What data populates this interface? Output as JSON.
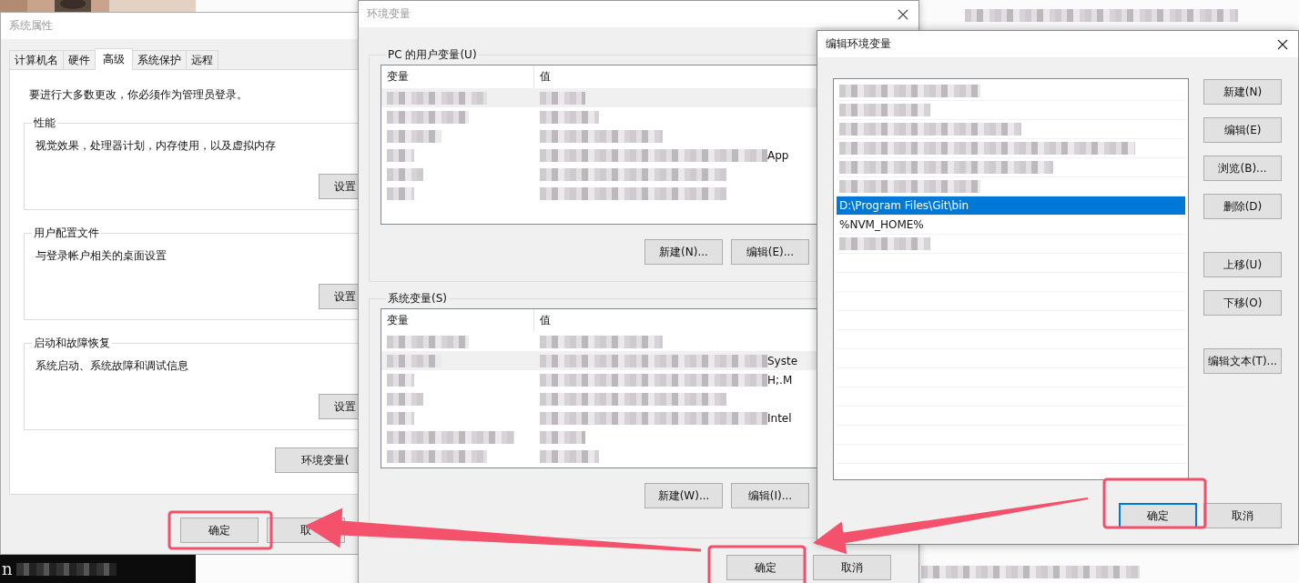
{
  "desktop": {
    "terminal_text": "n"
  },
  "system_properties": {
    "title": "系统属性",
    "tabs": [
      {
        "label": "计算机名",
        "selected": false
      },
      {
        "label": "硬件",
        "selected": false
      },
      {
        "label": "高级",
        "selected": true
      },
      {
        "label": "系统保护",
        "selected": false
      },
      {
        "label": "远程",
        "selected": false
      }
    ],
    "notice": "要进行大多数更改，你必须作为管理员登录。",
    "groups": [
      {
        "title": "性能",
        "description": "视觉效果，处理器计划，内存使用，以及虚拟内存",
        "button": "设置"
      },
      {
        "title": "用户配置文件",
        "description": "与登录帐户相关的桌面设置",
        "button": "设置"
      },
      {
        "title": "启动和故障恢复",
        "description": "系统启动、系统故障和调试信息",
        "button": "设置"
      }
    ],
    "env_button": "环境变量(",
    "ok_button": {
      "label": "确定",
      "default": false
    },
    "cancel_button": "取"
  },
  "environment_variables": {
    "title": "环境变量",
    "sections": [
      {
        "title": "PC 的用户变量(U)",
        "columns": [
          "变量",
          "值"
        ],
        "rows": [
          {
            "selected": true
          },
          {
            "selected": false
          },
          {
            "selected": false
          },
          {
            "selected": false,
            "value_tail": "App"
          },
          {
            "selected": false
          },
          {
            "selected": false
          }
        ],
        "buttons": [
          "新建(N)...",
          "编辑(E)..."
        ]
      },
      {
        "title": "系统变量(S)",
        "columns": [
          "变量",
          "值"
        ],
        "rows": [
          {
            "selected": false
          },
          {
            "selected": true,
            "value_tail": "Syste"
          },
          {
            "selected": false,
            "value_tail": "H;.M"
          },
          {
            "selected": false
          },
          {
            "selected": false,
            "value_tail": "Intel"
          },
          {
            "selected": false
          },
          {
            "selected": false
          }
        ],
        "buttons": [
          "新建(W)...",
          "编辑(I)..."
        ]
      }
    ],
    "ok_button": {
      "label": "确定",
      "default": false
    },
    "cancel_button": "取消"
  },
  "edit_environment_variable": {
    "title": "编辑环境变量",
    "paths": [
      {
        "kind": "blurred",
        "selected": false
      },
      {
        "kind": "blurred",
        "selected": false
      },
      {
        "kind": "blurred",
        "selected": false
      },
      {
        "kind": "blurred",
        "selected": false
      },
      {
        "kind": "blurred",
        "selected": false
      },
      {
        "kind": "blurred",
        "selected": false
      },
      {
        "kind": "text",
        "text": "D:\\Program Files\\Git\\bin",
        "selected": true
      },
      {
        "kind": "text",
        "text": "%NVM_HOME%",
        "selected": false
      },
      {
        "kind": "blurred",
        "selected": false
      }
    ],
    "button_groups": [
      [
        "新建(N)",
        "编辑(E)",
        "浏览(B)...",
        "删除(D)"
      ],
      [
        "上移(U)",
        "下移(O)"
      ],
      [
        "编辑文本(T)..."
      ]
    ],
    "ok_button": {
      "label": "确定",
      "default": true
    },
    "cancel_button": "取消"
  }
}
